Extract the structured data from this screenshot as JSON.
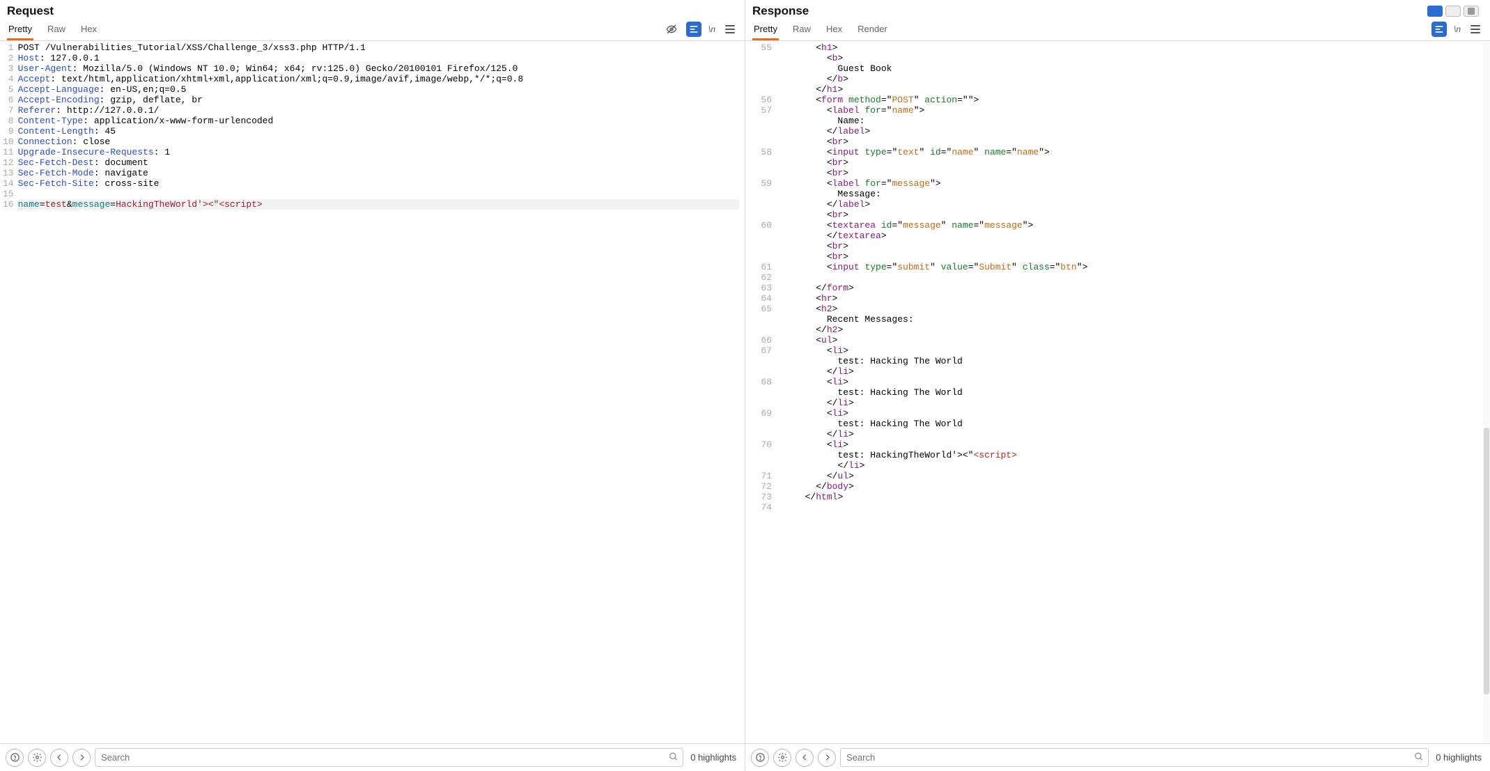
{
  "layout_buttons": [
    "side-by-side",
    "stacked",
    "single"
  ],
  "request": {
    "title": "Request",
    "tabs": [
      "Pretty",
      "Raw",
      "Hex"
    ],
    "active_tab": "Pretty",
    "wrap_char": "\\n",
    "lines": [
      {
        "n": 1,
        "segs": [
          [
            "POST /Vulnerabilities_Tutorial/XSS/Challenge_3/xss3.php HTTP/1.1",
            ""
          ]
        ]
      },
      {
        "n": 2,
        "segs": [
          [
            "Host",
            "c-blue"
          ],
          [
            ": 127.0.0.1",
            ""
          ]
        ]
      },
      {
        "n": 3,
        "segs": [
          [
            "User-Agent",
            "c-blue"
          ],
          [
            ": Mozilla/5.0 (Windows NT 10.0; Win64; x64; rv:125.0) Gecko/20100101 Firefox/125.0",
            ""
          ]
        ]
      },
      {
        "n": 4,
        "segs": [
          [
            "Accept",
            "c-blue"
          ],
          [
            ": text/html,application/xhtml+xml,application/xml;q=0.9,image/avif,image/webp,*/*;q=0.8",
            ""
          ]
        ]
      },
      {
        "n": 5,
        "segs": [
          [
            "Accept-Language",
            "c-blue"
          ],
          [
            ": en-US,en;q=0.5",
            ""
          ]
        ]
      },
      {
        "n": 6,
        "segs": [
          [
            "Accept-Encoding",
            "c-blue"
          ],
          [
            ": gzip, deflate, br",
            ""
          ]
        ]
      },
      {
        "n": 7,
        "segs": [
          [
            "Referer",
            "c-blue"
          ],
          [
            ": http://127.0.0.1/",
            ""
          ]
        ]
      },
      {
        "n": 8,
        "segs": [
          [
            "Content-Type",
            "c-blue"
          ],
          [
            ": application/x-www-form-urlencoded",
            ""
          ]
        ]
      },
      {
        "n": 9,
        "segs": [
          [
            "Content-Length",
            "c-blue"
          ],
          [
            ": 45",
            ""
          ]
        ]
      },
      {
        "n": 10,
        "segs": [
          [
            "Connection",
            "c-blue"
          ],
          [
            ": close",
            ""
          ]
        ]
      },
      {
        "n": 11,
        "segs": [
          [
            "Upgrade-Insecure-Requests",
            "c-blue"
          ],
          [
            ": 1",
            ""
          ]
        ]
      },
      {
        "n": 12,
        "segs": [
          [
            "Sec-Fetch-Dest",
            "c-blue"
          ],
          [
            ": document",
            ""
          ]
        ]
      },
      {
        "n": 13,
        "segs": [
          [
            "Sec-Fetch-Mode",
            "c-blue"
          ],
          [
            ": navigate",
            ""
          ]
        ]
      },
      {
        "n": 14,
        "segs": [
          [
            "Sec-Fetch-Site",
            "c-blue"
          ],
          [
            ": cross-site",
            ""
          ]
        ]
      },
      {
        "n": 15,
        "segs": [
          [
            "",
            ""
          ]
        ]
      },
      {
        "n": 16,
        "hl": true,
        "segs": [
          [
            "name",
            "c-teal"
          ],
          [
            "=",
            ""
          ],
          [
            "test",
            "c-dred"
          ],
          [
            "&",
            ""
          ],
          [
            "message",
            "c-teal"
          ],
          [
            "=",
            ""
          ],
          [
            "HackingTheWorld'><\"<script>",
            "c-dred"
          ]
        ]
      }
    ],
    "search_placeholder": "Search",
    "highlights": "0 highlights"
  },
  "response": {
    "title": "Response",
    "tabs": [
      "Pretty",
      "Raw",
      "Hex",
      "Render"
    ],
    "active_tab": "Pretty",
    "wrap_char": "\\n",
    "lines": [
      {
        "n": 55,
        "indent": 2,
        "segs": [
          [
            "<",
            ""
          ],
          [
            "h1",
            "c-purple"
          ],
          [
            ">",
            ""
          ]
        ]
      },
      {
        "n": "",
        "indent": 3,
        "segs": [
          [
            "<",
            ""
          ],
          [
            "b",
            "c-purple"
          ],
          [
            ">",
            ""
          ]
        ]
      },
      {
        "n": "",
        "indent": 4,
        "segs": [
          [
            "Guest Book",
            ""
          ]
        ]
      },
      {
        "n": "",
        "indent": 3,
        "segs": [
          [
            "</",
            ""
          ],
          [
            "b",
            "c-purple"
          ],
          [
            ">",
            ""
          ]
        ]
      },
      {
        "n": "",
        "indent": 2,
        "segs": [
          [
            "</",
            ""
          ],
          [
            "h1",
            "c-purple"
          ],
          [
            ">",
            ""
          ]
        ]
      },
      {
        "n": 56,
        "indent": 2,
        "segs": [
          [
            "<",
            ""
          ],
          [
            "form",
            "c-purple"
          ],
          [
            " method",
            "c-green"
          ],
          [
            "=\"",
            ""
          ],
          [
            "POST",
            "c-orange"
          ],
          [
            "\" ",
            ""
          ],
          [
            "action",
            "c-green"
          ],
          [
            "=\"",
            ""
          ],
          [
            "",
            "c-orange"
          ],
          [
            "\">",
            ""
          ]
        ]
      },
      {
        "n": 57,
        "indent": 3,
        "segs": [
          [
            "<",
            ""
          ],
          [
            "label",
            "c-purple"
          ],
          [
            " for",
            "c-green"
          ],
          [
            "=\"",
            ""
          ],
          [
            "name",
            "c-orange"
          ],
          [
            "\">",
            ""
          ]
        ]
      },
      {
        "n": "",
        "indent": 4,
        "segs": [
          [
            "Name:",
            ""
          ]
        ]
      },
      {
        "n": "",
        "indent": 3,
        "segs": [
          [
            "</",
            ""
          ],
          [
            "label",
            "c-purple"
          ],
          [
            ">",
            ""
          ]
        ]
      },
      {
        "n": "",
        "indent": 3,
        "segs": [
          [
            "<",
            ""
          ],
          [
            "br",
            "c-purple"
          ],
          [
            ">",
            ""
          ]
        ]
      },
      {
        "n": 58,
        "indent": 3,
        "segs": [
          [
            "<",
            ""
          ],
          [
            "input",
            "c-purple"
          ],
          [
            " type",
            "c-green"
          ],
          [
            "=\"",
            ""
          ],
          [
            "text",
            "c-orange"
          ],
          [
            "\" ",
            ""
          ],
          [
            "id",
            "c-green"
          ],
          [
            "=\"",
            ""
          ],
          [
            "name",
            "c-orange"
          ],
          [
            "\" ",
            ""
          ],
          [
            "name",
            "c-green"
          ],
          [
            "=\"",
            ""
          ],
          [
            "name",
            "c-orange"
          ],
          [
            "\">",
            ""
          ]
        ]
      },
      {
        "n": "",
        "indent": 3,
        "segs": [
          [
            "<",
            ""
          ],
          [
            "br",
            "c-purple"
          ],
          [
            ">",
            ""
          ]
        ]
      },
      {
        "n": "",
        "indent": 3,
        "segs": [
          [
            "<",
            ""
          ],
          [
            "br",
            "c-purple"
          ],
          [
            ">",
            ""
          ]
        ]
      },
      {
        "n": 59,
        "indent": 3,
        "segs": [
          [
            "<",
            ""
          ],
          [
            "label",
            "c-purple"
          ],
          [
            " for",
            "c-green"
          ],
          [
            "=\"",
            ""
          ],
          [
            "message",
            "c-orange"
          ],
          [
            "\">",
            ""
          ]
        ]
      },
      {
        "n": "",
        "indent": 4,
        "segs": [
          [
            "Message:",
            ""
          ]
        ]
      },
      {
        "n": "",
        "indent": 3,
        "segs": [
          [
            "</",
            ""
          ],
          [
            "label",
            "c-purple"
          ],
          [
            ">",
            ""
          ]
        ]
      },
      {
        "n": "",
        "indent": 3,
        "segs": [
          [
            "<",
            ""
          ],
          [
            "br",
            "c-purple"
          ],
          [
            ">",
            ""
          ]
        ]
      },
      {
        "n": 60,
        "indent": 3,
        "segs": [
          [
            "<",
            ""
          ],
          [
            "textarea",
            "c-purple"
          ],
          [
            " id",
            "c-green"
          ],
          [
            "=\"",
            ""
          ],
          [
            "message",
            "c-orange"
          ],
          [
            "\" ",
            ""
          ],
          [
            "name",
            "c-green"
          ],
          [
            "=\"",
            ""
          ],
          [
            "message",
            "c-orange"
          ],
          [
            "\">",
            ""
          ]
        ]
      },
      {
        "n": "",
        "indent": 3,
        "segs": [
          [
            "</",
            ""
          ],
          [
            "textarea",
            "c-purple"
          ],
          [
            ">",
            ""
          ]
        ]
      },
      {
        "n": "",
        "indent": 3,
        "segs": [
          [
            "<",
            ""
          ],
          [
            "br",
            "c-purple"
          ],
          [
            ">",
            ""
          ]
        ]
      },
      {
        "n": "",
        "indent": 3,
        "segs": [
          [
            "<",
            ""
          ],
          [
            "br",
            "c-purple"
          ],
          [
            ">",
            ""
          ]
        ]
      },
      {
        "n": 61,
        "indent": 3,
        "segs": [
          [
            "<",
            ""
          ],
          [
            "input",
            "c-purple"
          ],
          [
            " type",
            "c-green"
          ],
          [
            "=\"",
            ""
          ],
          [
            "submit",
            "c-orange"
          ],
          [
            "\" ",
            ""
          ],
          [
            "value",
            "c-green"
          ],
          [
            "=\"",
            ""
          ],
          [
            "Submit",
            "c-orange"
          ],
          [
            "\" ",
            ""
          ],
          [
            "class",
            "c-green"
          ],
          [
            "=\"",
            ""
          ],
          [
            "btn",
            "c-orange"
          ],
          [
            "\">",
            ""
          ]
        ]
      },
      {
        "n": 62,
        "indent": 0,
        "segs": [
          [
            "",
            ""
          ]
        ]
      },
      {
        "n": 63,
        "indent": 2,
        "segs": [
          [
            "</",
            ""
          ],
          [
            "form",
            "c-purple"
          ],
          [
            ">",
            ""
          ]
        ]
      },
      {
        "n": 64,
        "indent": 2,
        "segs": [
          [
            "<",
            ""
          ],
          [
            "hr",
            "c-purple"
          ],
          [
            ">",
            ""
          ]
        ]
      },
      {
        "n": 65,
        "indent": 2,
        "segs": [
          [
            "<",
            ""
          ],
          [
            "h2",
            "c-purple"
          ],
          [
            ">",
            ""
          ]
        ]
      },
      {
        "n": "",
        "indent": 3,
        "segs": [
          [
            "Recent Messages:",
            ""
          ]
        ]
      },
      {
        "n": "",
        "indent": 2,
        "segs": [
          [
            "</",
            ""
          ],
          [
            "h2",
            "c-purple"
          ],
          [
            ">",
            ""
          ]
        ]
      },
      {
        "n": 66,
        "indent": 2,
        "segs": [
          [
            "<",
            ""
          ],
          [
            "ul",
            "c-purple"
          ],
          [
            ">",
            ""
          ]
        ]
      },
      {
        "n": 67,
        "indent": 3,
        "segs": [
          [
            "<",
            ""
          ],
          [
            "li",
            "c-purple"
          ],
          [
            ">",
            ""
          ]
        ]
      },
      {
        "n": "",
        "indent": 4,
        "segs": [
          [
            "test: Hacking The World",
            ""
          ]
        ]
      },
      {
        "n": "",
        "indent": 3,
        "segs": [
          [
            "</",
            ""
          ],
          [
            "li",
            "c-purple"
          ],
          [
            ">",
            ""
          ]
        ]
      },
      {
        "n": 68,
        "indent": 3,
        "segs": [
          [
            "<",
            ""
          ],
          [
            "li",
            "c-purple"
          ],
          [
            ">",
            ""
          ]
        ]
      },
      {
        "n": "",
        "indent": 4,
        "segs": [
          [
            "test: Hacking The World",
            ""
          ]
        ]
      },
      {
        "n": "",
        "indent": 3,
        "segs": [
          [
            "</",
            ""
          ],
          [
            "li",
            "c-purple"
          ],
          [
            ">",
            ""
          ]
        ]
      },
      {
        "n": 69,
        "indent": 3,
        "segs": [
          [
            "<",
            ""
          ],
          [
            "li",
            "c-purple"
          ],
          [
            ">",
            ""
          ]
        ]
      },
      {
        "n": "",
        "indent": 4,
        "segs": [
          [
            "test: Hacking The World",
            ""
          ]
        ]
      },
      {
        "n": "",
        "indent": 3,
        "segs": [
          [
            "</",
            ""
          ],
          [
            "li",
            "c-purple"
          ],
          [
            ">",
            ""
          ]
        ]
      },
      {
        "n": 70,
        "indent": 3,
        "segs": [
          [
            "<",
            ""
          ],
          [
            "li",
            "c-purple"
          ],
          [
            ">",
            ""
          ]
        ]
      },
      {
        "n": "",
        "indent": 4,
        "segs": [
          [
            "test: HackingTheWorld'><\"",
            ""
          ],
          [
            "<script>",
            "c-red"
          ]
        ]
      },
      {
        "n": "",
        "indent": 4,
        "segs": [
          [
            "</",
            ""
          ],
          [
            "li",
            "c-purple"
          ],
          [
            ">",
            ""
          ]
        ]
      },
      {
        "n": 71,
        "indent": 3,
        "segs": [
          [
            "</",
            ""
          ],
          [
            "ul",
            "c-purple"
          ],
          [
            ">",
            ""
          ]
        ]
      },
      {
        "n": 72,
        "indent": 2,
        "segs": [
          [
            "</",
            ""
          ],
          [
            "body",
            "c-purple"
          ],
          [
            ">",
            ""
          ]
        ]
      },
      {
        "n": 73,
        "indent": 1,
        "segs": [
          [
            "</",
            ""
          ],
          [
            "html",
            "c-purple"
          ],
          [
            ">",
            ""
          ]
        ]
      },
      {
        "n": 74,
        "indent": 0,
        "segs": [
          [
            "",
            ""
          ]
        ]
      }
    ],
    "search_placeholder": "Search",
    "highlights": "0 highlights"
  }
}
